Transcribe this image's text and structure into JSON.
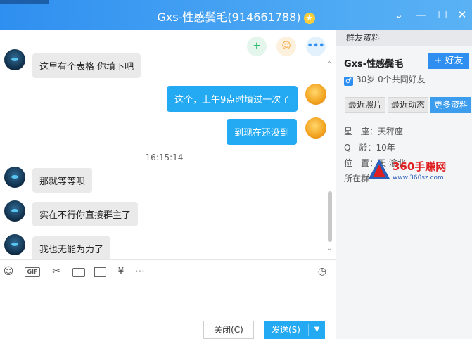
{
  "window": {
    "title": "Gxs-性感鬓毛(914661788)",
    "crown_icon": "crown-icon",
    "controls": [
      "chevron-down-icon",
      "minimize-icon",
      "maximize-icon",
      "close-icon"
    ]
  },
  "chat": {
    "top_icons": [
      "add-member-icon",
      "invite-icon",
      "more-icon"
    ],
    "messages": [
      {
        "side": "left",
        "text": "这里有个表格 你填下吧"
      },
      {
        "side": "right",
        "text": "这个，上午9点时填过一次了"
      },
      {
        "side": "right",
        "text": "到现在还没到"
      },
      {
        "side": "time",
        "text": "16:15:14"
      },
      {
        "side": "left",
        "text": "那就等等呗"
      },
      {
        "side": "left",
        "text": "实在不行你直接群主了"
      },
      {
        "side": "left",
        "text": "我也无能为力了"
      }
    ]
  },
  "toolbar": {
    "icons": [
      "emoji-icon",
      "gif-icon",
      "scissors-icon",
      "folder-icon",
      "image-icon",
      "red-packet-icon",
      "more-icon",
      "clock-icon"
    ],
    "gif_label": "GIF"
  },
  "input": {
    "close_label": "关闭(C)",
    "send_label": "发送(S)"
  },
  "panel": {
    "header": "群友资料",
    "name": "Gxs-性感鬓毛",
    "add_friend_label": "+ 好友",
    "gender_symbol": "♂",
    "info": "30岁  0个共同好友",
    "tabs": [
      "最近照片",
      "最近动态",
      "更多资料"
    ],
    "active_tab": "更多资料",
    "rows": [
      {
        "label": "星　座：",
        "value": "天秤座"
      },
      {
        "label": "Q　龄：",
        "value": "10年"
      },
      {
        "label": "位　置：",
        "value": "天 渝北"
      },
      {
        "label": "所在群",
        "value": ""
      }
    ]
  },
  "watermark": {
    "text": "360手赚网",
    "sub": "www.360sz.com"
  },
  "colors": {
    "accent": "#2f8ff0",
    "bubble_right": "#24aaf2",
    "bubble_left": "#eaeaea"
  }
}
